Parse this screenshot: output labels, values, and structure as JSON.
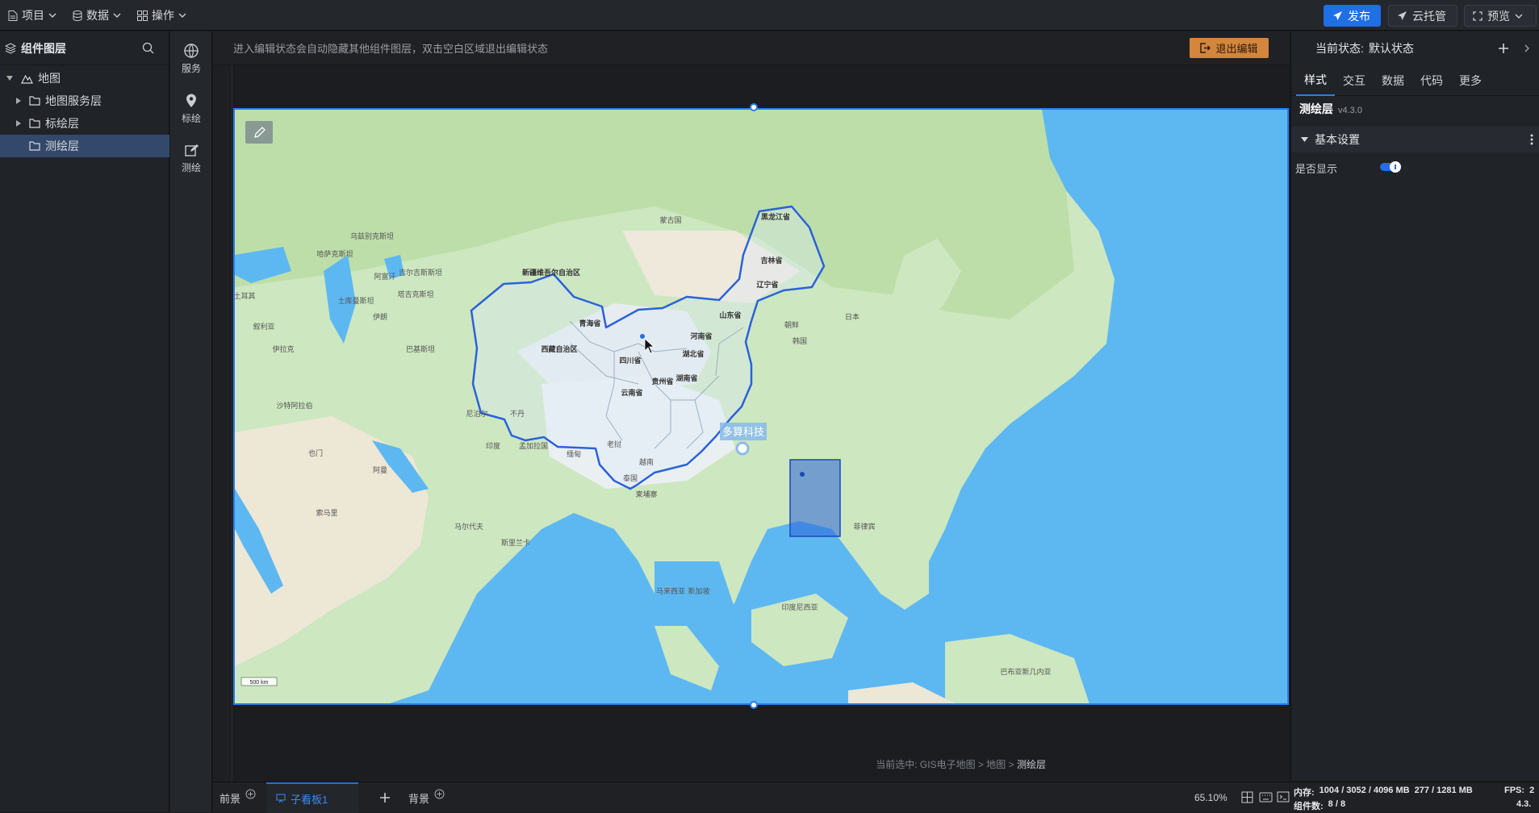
{
  "topbar": {
    "menu": [
      {
        "label": "项目",
        "icon": "document-icon"
      },
      {
        "label": "数据",
        "icon": "database-icon"
      },
      {
        "label": "操作",
        "icon": "grid-icon"
      }
    ],
    "publish_label": "发布",
    "cloud_label": "云托管",
    "preview_label": "预览"
  },
  "layers_panel": {
    "title": "组件图层",
    "tree": [
      {
        "label": "地图",
        "level": 0
      },
      {
        "label": "地图服务层",
        "level": 1
      },
      {
        "label": "标绘层",
        "level": 1
      },
      {
        "label": "测绘层",
        "level": 1,
        "selected": true
      }
    ]
  },
  "icon_bar": {
    "items": [
      {
        "label": "服务",
        "icon": "globe-icon"
      },
      {
        "label": "标绘",
        "icon": "map-pin-icon"
      },
      {
        "label": "测绘",
        "icon": "edit-icon"
      }
    ]
  },
  "canvas": {
    "hint": "进入编辑状态会自动隐藏其他组件图层，双击空白区域退出编辑状态",
    "exit_label": "退出编辑",
    "breadcrumb_prefix": "当前选中:",
    "breadcrumb": [
      "GIS电子地图",
      "地图",
      "测绘层"
    ]
  },
  "map": {
    "marker_label": "多算科技",
    "scale_label": "500 km",
    "labels": [
      "新疆维吾尔自治区",
      "西藏自治区",
      "青海省",
      "四川省",
      "云南省",
      "贵州省",
      "湖南省",
      "湖北省",
      "河南省",
      "山东省",
      "辽宁省",
      "吉林省",
      "黑龙江省",
      "土耳其",
      "叙利亚",
      "伊拉克",
      "伊朗",
      "沙特阿拉伯",
      "也门",
      "阿曼",
      "索马里",
      "印度",
      "巴基斯坦",
      "阿富汗",
      "哈萨克斯坦",
      "乌兹别克斯坦",
      "土库曼斯坦",
      "吉尔吉斯斯坦",
      "塔吉克斯坦",
      "蒙古国",
      "朝鲜",
      "韩国",
      "日本",
      "泰国",
      "越南",
      "老挝",
      "缅甸",
      "柬埔寨",
      "马来西亚",
      "新加坡",
      "印度尼西亚",
      "菲律宾",
      "斯里兰卡",
      "马尔代夫",
      "巴布亚新几内亚",
      "孟加拉国",
      "尼泊尔",
      "不丹"
    ]
  },
  "props": {
    "state_prefix": "当前状态:",
    "state_value": "默认状态",
    "tabs": [
      "样式",
      "交互",
      "数据",
      "代码",
      "更多"
    ],
    "active_tab": "样式",
    "component_name": "测绘层",
    "version": "v4.3.0",
    "section": "基本设置",
    "show_label": "是否显示",
    "show_value": true
  },
  "bottom": {
    "tabs": [
      "前景",
      "子看板1",
      "背景"
    ],
    "zoom": "65.10%"
  },
  "status": {
    "memory_label": "内存:",
    "memory_value": "1004 / 3052 / 4096 MB",
    "memory_extra": "277 / 1281 MB",
    "fps_label": "FPS:",
    "fps_value": "2",
    "components_label": "组件数:",
    "components_value": "8 / 8",
    "version": "4.3."
  },
  "colors": {
    "accent": "#1f6fe5",
    "selection": "#33496b",
    "exit_button": "#d4863d",
    "map_sea": "#5db8f2",
    "boundary": "#2b62d9"
  }
}
